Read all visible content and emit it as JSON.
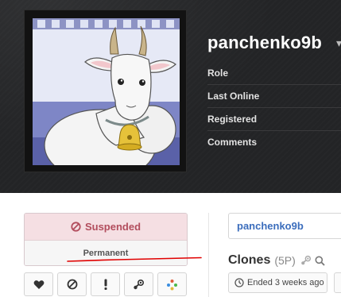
{
  "profile": {
    "username": "panchenko9b",
    "info_labels": [
      "Role",
      "Last Online",
      "Registered",
      "Comments"
    ]
  },
  "avatar": {
    "icon": "goat-avatar-image",
    "colors": {
      "sky": "#9ea6d8",
      "wall": "#c9cfea",
      "goat": "#f4f4f4",
      "bell": "#e6c23a"
    }
  },
  "status": {
    "label": "Suspended",
    "duration": "Permanent",
    "icon": "ban-icon",
    "colors": {
      "background": "#f5dfe3",
      "text": "#b24d5d"
    }
  },
  "actions": [
    {
      "name": "favorite-button",
      "icon": "heart-icon"
    },
    {
      "name": "block-button",
      "icon": "ban-icon"
    },
    {
      "name": "report-button",
      "icon": "exclamation-icon"
    },
    {
      "name": "steam-button",
      "icon": "steam-icon"
    },
    {
      "name": "more-button",
      "icon": "dots-icon"
    }
  ],
  "linked_user": {
    "username": "panchenko9b",
    "color": "#3b6dbc"
  },
  "clones": {
    "title": "Clones",
    "count": "(5P)",
    "icons": [
      "steam-icon",
      "search-icon"
    ],
    "ended_text": "Ended 3 weeks ago",
    "ended_icon": "clock-icon"
  },
  "annotation": {
    "underline_color": "#e00000"
  }
}
